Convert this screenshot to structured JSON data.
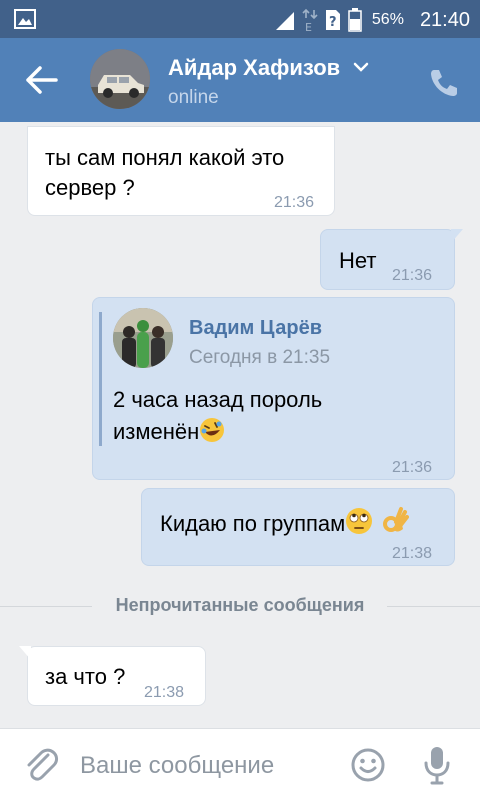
{
  "status_bar": {
    "battery_percent": "56%",
    "time": "21:40",
    "icons": [
      "image-icon",
      "data-arrows-icon",
      "e-network-icon",
      "no-sim-icon",
      "battery-icon"
    ]
  },
  "header": {
    "contact_name": "Айдар Хафизов",
    "status": "online",
    "icons": [
      "back-arrow-icon",
      "chevron-down-icon",
      "phone-icon"
    ]
  },
  "messages": [
    {
      "direction": "in",
      "lines": [
        "ты сам понял какой это",
        "сервер ?"
      ],
      "time": "21:36"
    },
    {
      "direction": "out",
      "lines": [
        "Нет"
      ],
      "time": "21:36"
    },
    {
      "direction": "out",
      "forwarded": {
        "author": "Вадим Царёв",
        "date": "Сегодня в 21:35",
        "lines": [
          "2 часа назад пороль",
          "изменён"
        ],
        "emoji": "rolling-on-floor-laughing-emoji"
      },
      "time": "21:36"
    },
    {
      "direction": "out",
      "lines": [
        "Кидаю по группам"
      ],
      "emojis": [
        "rolling-eyes-emoji",
        "ok-hand-emoji"
      ],
      "time": "21:38"
    }
  ],
  "unread_divider": "Непрочитанные сообщения",
  "unread_messages": [
    {
      "direction": "in",
      "lines": [
        "за что ?"
      ],
      "time": "21:38"
    }
  ],
  "composer": {
    "placeholder": "Ваше сообщение",
    "value": "",
    "icons": [
      "paperclip-icon",
      "smiley-icon",
      "microphone-icon"
    ]
  },
  "colors": {
    "status_bar": "#41618a",
    "header": "#5181b8",
    "background": "#edeef0",
    "incoming_bubble": "#ffffff",
    "outgoing_bubble": "#d3e1f2",
    "forward_author": "#4a74a6"
  }
}
